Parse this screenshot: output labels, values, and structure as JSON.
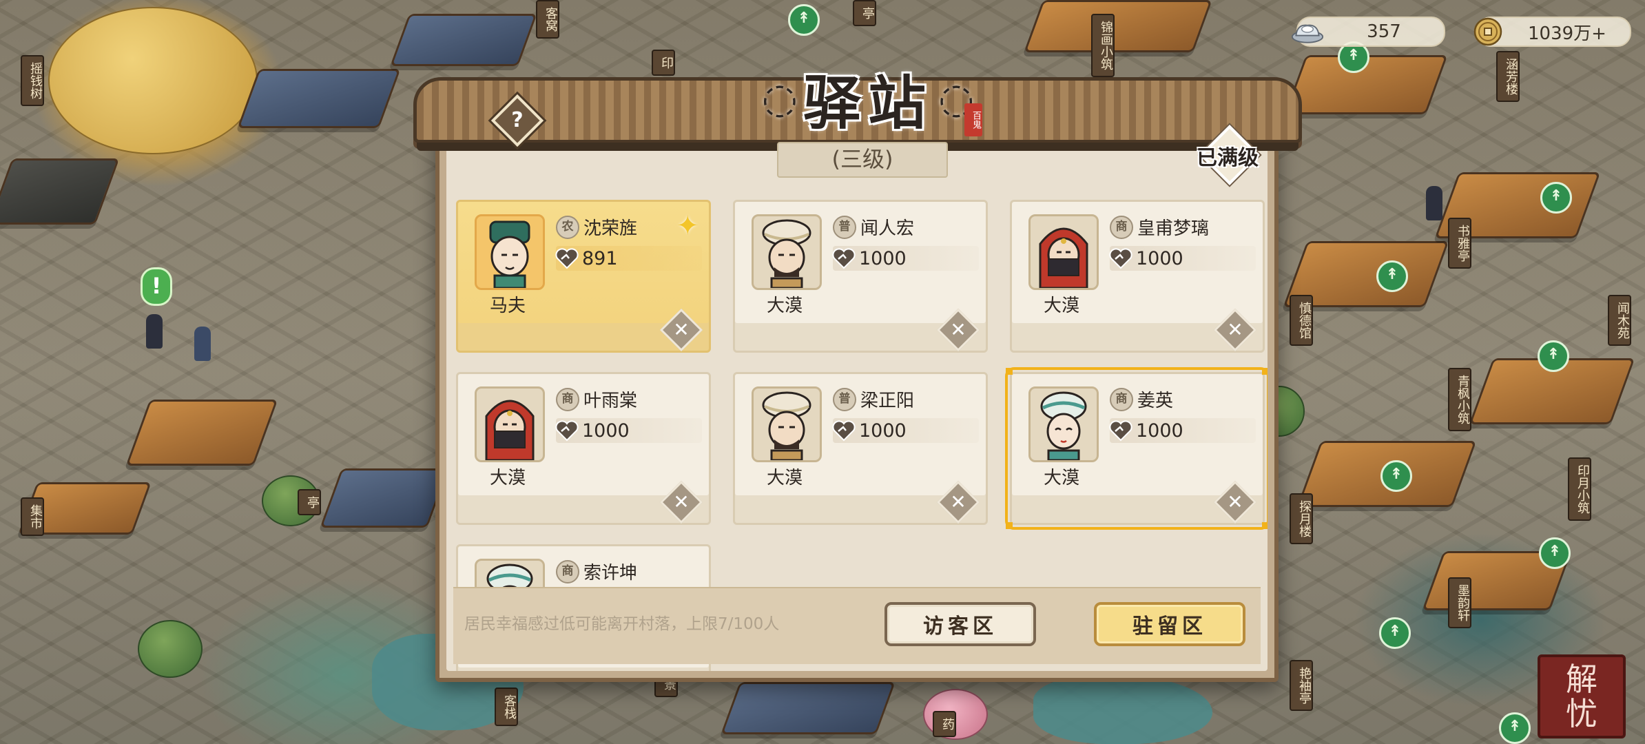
{
  "currency": {
    "silver": "357",
    "coins": "1039万+"
  },
  "map": {
    "labels": [
      {
        "text": "摇钱树",
        "id": "yaoqianshu"
      },
      {
        "text": "客窝",
        "id": "kewo"
      },
      {
        "text": "印",
        "id": "yin"
      },
      {
        "text": "亭",
        "id": "ting-top"
      },
      {
        "text": "锦画小筑",
        "id": "jinhua"
      },
      {
        "text": "涵芳楼",
        "id": "hanfang"
      },
      {
        "text": "书雅亭",
        "id": "shuya"
      },
      {
        "text": "慎德馆",
        "id": "shende"
      },
      {
        "text": "闻木苑",
        "id": "wenmu"
      },
      {
        "text": "青枫小筑",
        "id": "qingfeng"
      },
      {
        "text": "探月楼",
        "id": "tanyue"
      },
      {
        "text": "印月小筑",
        "id": "yinyue"
      },
      {
        "text": "墨韵轩",
        "id": "moyun"
      },
      {
        "text": "艳袖亭",
        "id": "yanxiu"
      },
      {
        "text": "集市",
        "id": "jishi"
      },
      {
        "text": "亭",
        "id": "ting"
      },
      {
        "text": "客栈",
        "id": "kezhan"
      },
      {
        "text": "景",
        "id": "jing"
      },
      {
        "text": "药",
        "id": "yao"
      }
    ]
  },
  "modal": {
    "title": "驿站",
    "seal": "百鬼",
    "level": "(三级)",
    "maxed": "已满级",
    "help": "?",
    "notice": "居民幸福感过低可能离开村落，上限7/100人",
    "visitor_button": "访客区",
    "stay_button": "驻留区",
    "cards": [
      {
        "name": "沈荣旌",
        "prof": "农",
        "satisfaction": "891",
        "origin": "马夫",
        "style": "gold",
        "hat": "green"
      },
      {
        "name": "闻人宏",
        "prof": "普",
        "satisfaction": "1000",
        "origin": "大漠",
        "style": "normal",
        "hat": "turban"
      },
      {
        "name": "皇甫梦璃",
        "prof": "商",
        "satisfaction": "1000",
        "origin": "大漠",
        "style": "normal",
        "hat": "redhood"
      },
      {
        "name": "叶雨棠",
        "prof": "商",
        "satisfaction": "1000",
        "origin": "大漠",
        "style": "normal",
        "hat": "redhood"
      },
      {
        "name": "梁正阳",
        "prof": "普",
        "satisfaction": "1000",
        "origin": "大漠",
        "style": "normal",
        "hat": "turban"
      },
      {
        "name": "姜英",
        "prof": "商",
        "satisfaction": "1000",
        "origin": "大漠",
        "style": "selected",
        "hat": "tealturban"
      },
      {
        "name": "索许坤",
        "prof": "商",
        "satisfaction": "",
        "origin": "",
        "style": "partial",
        "hat": "tealturban"
      }
    ]
  },
  "brand": {
    "line1": "解",
    "line2": "忧"
  },
  "colors": {
    "accent_gold": "#f2b21a",
    "frame_brown": "#7d6245",
    "marker_green": "#2f8f4e"
  }
}
